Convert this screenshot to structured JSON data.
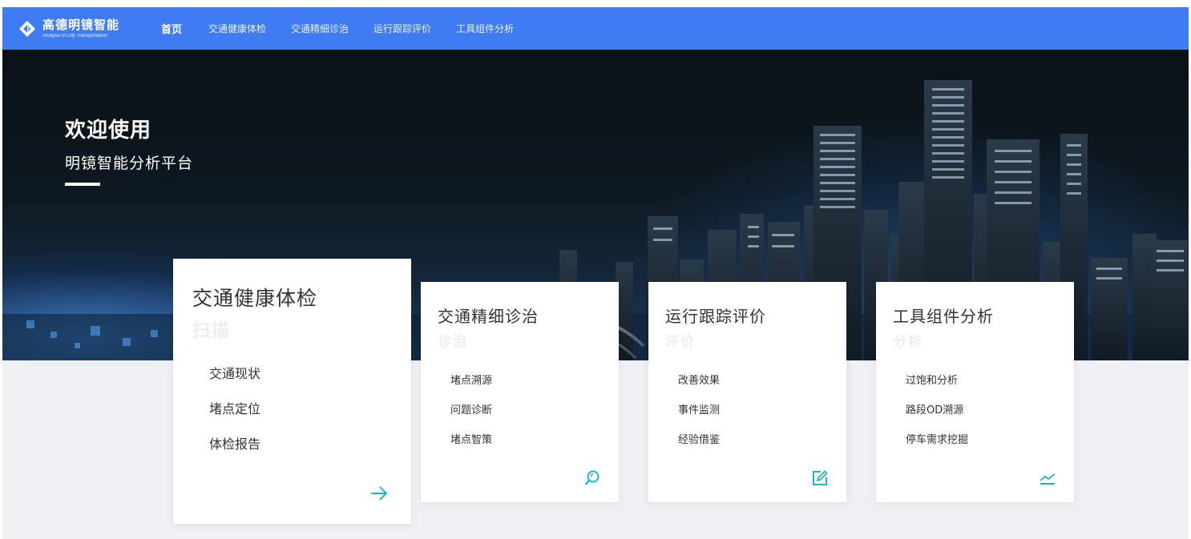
{
  "brand": {
    "title": "高德明镜智能",
    "subtitle": "Analysis of City Transportation"
  },
  "nav": {
    "items": [
      {
        "label": "首页",
        "active": true
      },
      {
        "label": "交通健康体检",
        "active": false
      },
      {
        "label": "交通精细诊治",
        "active": false
      },
      {
        "label": "运行跟踪评价",
        "active": false
      },
      {
        "label": "工具组件分析",
        "active": false
      }
    ]
  },
  "hero": {
    "title": "欢迎使用",
    "subtitle": "明镜智能分析平台"
  },
  "cards": [
    {
      "title": "交通健康体检",
      "ghost": "扫描",
      "items": [
        "交通现状",
        "堵点定位",
        "体检报告"
      ],
      "icon": "arrow-right-icon"
    },
    {
      "title": "交通精细诊治",
      "ghost": "诊治",
      "items": [
        "堵点溯源",
        "问题诊断",
        "堵点智策"
      ],
      "icon": "search-icon"
    },
    {
      "title": "运行跟踪评价",
      "ghost": "评价",
      "items": [
        "改善效果",
        "事件监测",
        "经验借鉴"
      ],
      "icon": "edit-icon"
    },
    {
      "title": "工具组件分析",
      "ghost": "分析",
      "items": [
        "过饱和分析",
        "路段OD溯源",
        "停车需求挖掘"
      ],
      "icon": "trend-chart-icon"
    }
  ],
  "colors": {
    "nav": "#3f7cf3",
    "accent": "#1fb5c8",
    "card_text": "#333333",
    "background": "#eef0f3"
  }
}
